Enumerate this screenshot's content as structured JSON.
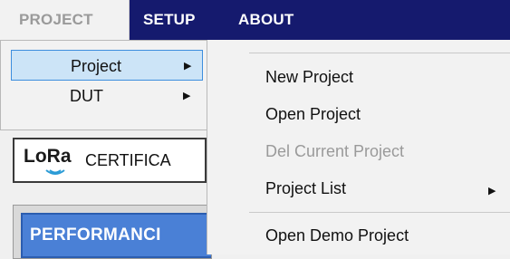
{
  "menubar": {
    "items": [
      {
        "label": "PROJECT"
      },
      {
        "label": "SETUP"
      },
      {
        "label": "ABOUT"
      }
    ]
  },
  "menu1": {
    "items": [
      {
        "label": "Project",
        "arrow": "▶"
      },
      {
        "label": "DUT",
        "arrow": "▶"
      }
    ]
  },
  "submenu": {
    "items": [
      {
        "label": "New Project"
      },
      {
        "label": "Open Project"
      },
      {
        "label": "Del Current Project",
        "disabled": true
      },
      {
        "label": "Project List",
        "arrow": "▶"
      },
      {
        "label": "Open Demo Project"
      }
    ]
  },
  "lora_panel": {
    "logo": "LoRa",
    "text": "CERTIFICA"
  },
  "performance_panel": {
    "text": "PERFORMANCI"
  },
  "colors": {
    "menubar": "#151a6e",
    "selected": "#cce4f7",
    "selected_border": "#3d8ede",
    "panel_blue": "#4a80d6"
  }
}
